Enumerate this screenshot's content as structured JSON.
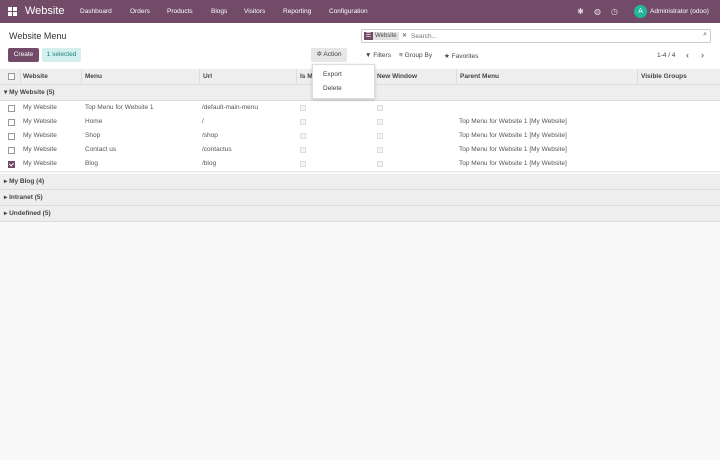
{
  "topbar": {
    "brand": "Website",
    "nav": [
      "Dashboard",
      "Orders",
      "Products",
      "Blogs",
      "Visitors",
      "Reporting",
      "Configuration"
    ],
    "user_initial": "A",
    "user_name": "Administrator (odoo)"
  },
  "page": {
    "title": "Website Menu"
  },
  "buttons": {
    "create": "Create",
    "selected": "1 selected",
    "action": "Action"
  },
  "action_menu": [
    "Export",
    "Delete"
  ],
  "search": {
    "facet": "Website",
    "placeholder": "Search..."
  },
  "filters": {
    "filters": "Filters",
    "group_by": "Group By",
    "favorites": "Favorites"
  },
  "pager": {
    "text": "1-4 / 4"
  },
  "columns": [
    "Website",
    "Menu",
    "Url",
    "Is M",
    "New Window",
    "Parent Menu",
    "Visible Groups"
  ],
  "groups": [
    {
      "label": "My Website (5)",
      "rows": [
        {
          "website": "My Website",
          "menu": "Top Menu for Website 1",
          "url": "/default-main-menu",
          "parent": "",
          "checked": false
        },
        {
          "website": "My Website",
          "menu": "Home",
          "url": "/",
          "parent": "Top Menu for Website 1 [My Website]",
          "checked": false
        },
        {
          "website": "My Website",
          "menu": "Shop",
          "url": "/shop",
          "parent": "Top Menu for Website 1 [My Website]",
          "checked": false
        },
        {
          "website": "My Website",
          "menu": "Contact us",
          "url": "/contactus",
          "parent": "Top Menu for Website 1 [My Website]",
          "checked": false
        },
        {
          "website": "My Website",
          "menu": "Blog",
          "url": "/blog",
          "parent": "Top Menu for Website 1 [My Website]",
          "checked": true
        }
      ]
    },
    {
      "label": "My Blog (4)"
    },
    {
      "label": "Intranet (5)"
    },
    {
      "label": "Undefined (5)"
    }
  ]
}
